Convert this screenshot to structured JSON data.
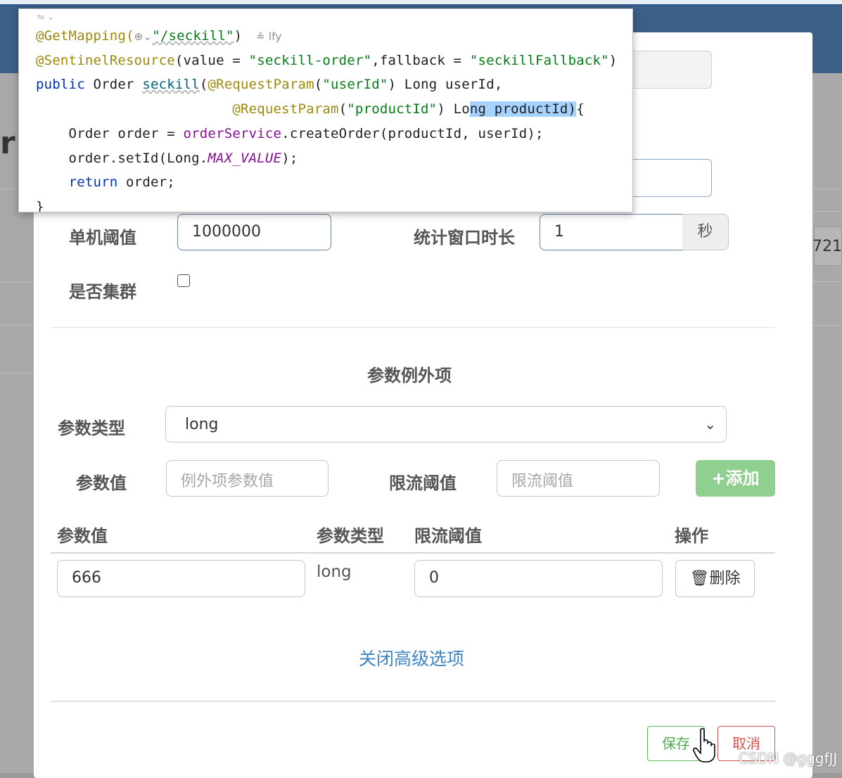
{
  "background": {
    "partial_letter": "r",
    "right_partial_value": "721"
  },
  "code_popup": {
    "lines": [
      {
        "segments": [
          {
            "text": "@GetMapping(",
            "cls": "ann"
          },
          {
            "text": "⊕⌄",
            "cls": "hint"
          },
          {
            "text": "\"/seckill\"",
            "cls": "str wavy"
          },
          {
            "text": ")",
            "cls": ""
          },
          {
            "text": "    ≗ lfy",
            "cls": "hint"
          }
        ]
      },
      {
        "segments": [
          {
            "text": "@SentinelResource",
            "cls": "ann"
          },
          {
            "text": "(value = ",
            "cls": ""
          },
          {
            "text": "\"seckill-order\"",
            "cls": "str"
          },
          {
            "text": ",fallback = ",
            "cls": ""
          },
          {
            "text": "\"seckillFallback\"",
            "cls": "str"
          },
          {
            "text": ")",
            "cls": ""
          }
        ]
      },
      {
        "segments": [
          {
            "text": "public ",
            "cls": "kw"
          },
          {
            "text": "Order ",
            "cls": ""
          },
          {
            "text": "seckill",
            "cls": "fn wavy"
          },
          {
            "text": "(",
            "cls": ""
          },
          {
            "text": "@RequestParam",
            "cls": "ann"
          },
          {
            "text": "(",
            "cls": ""
          },
          {
            "text": "\"userId\"",
            "cls": "str"
          },
          {
            "text": ") Long userId,",
            "cls": ""
          }
        ]
      },
      {
        "segments": [
          {
            "text": "                        ",
            "cls": ""
          },
          {
            "text": "@RequestParam",
            "cls": "ann"
          },
          {
            "text": "(",
            "cls": ""
          },
          {
            "text": "\"productId\"",
            "cls": "str"
          },
          {
            "text": ") Lo",
            "cls": ""
          },
          {
            "text": "ng productId)",
            "cls": "sel"
          },
          {
            "text": "{",
            "cls": ""
          }
        ]
      },
      {
        "segments": [
          {
            "text": "    Order order = ",
            "cls": ""
          },
          {
            "text": "orderService",
            "cls": "fld"
          },
          {
            "text": ".createOrder(productId, userId);",
            "cls": ""
          }
        ]
      },
      {
        "segments": [
          {
            "text": "    order.setId(Long.",
            "cls": ""
          },
          {
            "text": "MAX_VALUE",
            "cls": "const"
          },
          {
            "text": ");",
            "cls": ""
          }
        ]
      },
      {
        "segments": [
          {
            "text": "    ",
            "cls": ""
          },
          {
            "text": "return ",
            "cls": "kw"
          },
          {
            "text": "order;",
            "cls": ""
          }
        ]
      },
      {
        "segments": [
          {
            "text": "}",
            "cls": ""
          }
        ]
      }
    ]
  },
  "form": {
    "threshold_label": "单机阈值",
    "threshold_value": "1000000",
    "window_label": "统计窗口时长",
    "window_value": "1",
    "window_unit": "秒",
    "cluster_label": "是否集群",
    "cluster_checked": false
  },
  "exceptions": {
    "title": "参数例外项",
    "param_type_label": "参数类型",
    "param_type_selected": "long",
    "param_value_label": "参数值",
    "param_value_placeholder": "例外项参数值",
    "limit_label": "限流阈值",
    "limit_placeholder": "限流阈值",
    "add_button": "添加",
    "table": {
      "headers": [
        "参数值",
        "参数类型",
        "限流阈值",
        "操作"
      ],
      "rows": [
        {
          "value": "666",
          "type": "long",
          "limit": "0",
          "action": "删除"
        }
      ]
    }
  },
  "advanced_link": "关闭高级选项",
  "footer": {
    "save": "保存",
    "cancel": "取消"
  },
  "watermark": "CSDN @gggfJJ",
  "colors": {
    "header_bg": "#3a5f88",
    "add_button": "#8fcf8f",
    "save": "#5cb85c",
    "cancel": "#d9534f",
    "link": "#3e85c6"
  }
}
